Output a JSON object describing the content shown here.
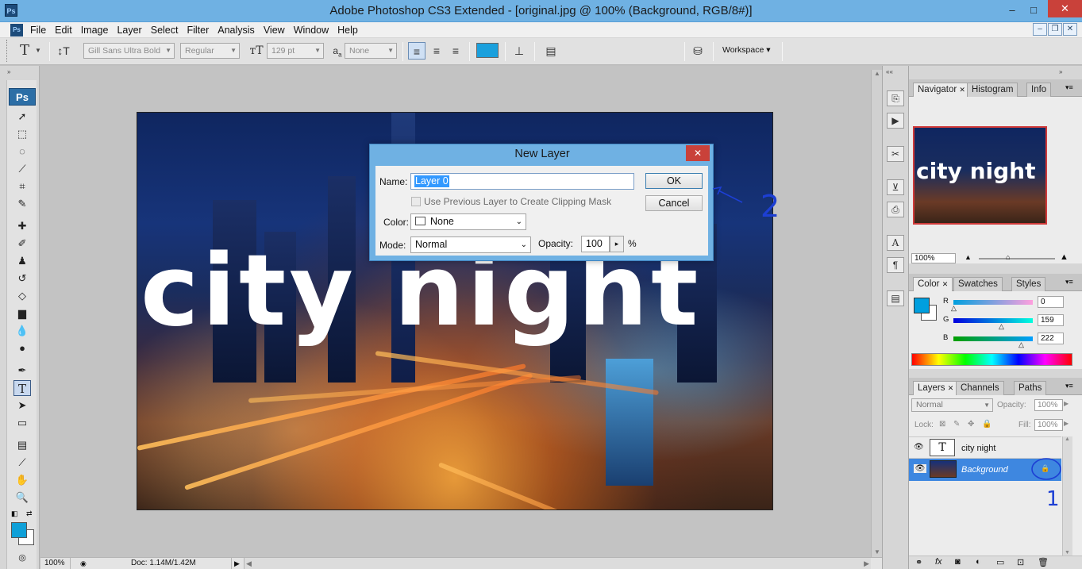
{
  "window": {
    "title": "Adobe Photoshop CS3 Extended - [original.jpg @ 100% (Background, RGB/8#)]",
    "app_icon": "Ps",
    "minimize": "–",
    "maximize": "□",
    "close": "✕"
  },
  "menu": {
    "app_icon": "Ps",
    "items": [
      "File",
      "Edit",
      "Image",
      "Layer",
      "Select",
      "Filter",
      "Analysis",
      "View",
      "Window",
      "Help"
    ],
    "doc_minimize": "–",
    "doc_restore": "❐",
    "doc_close": "✕"
  },
  "options": {
    "tool_glyph": "T",
    "font_family": "Gill Sans Ultra Bold",
    "font_style": "Regular",
    "font_size": "129 pt",
    "antialias_label": "a",
    "antialias": "None",
    "text_color": "#1aa0dd",
    "workspace": "Workspace ▾"
  },
  "toolbox": {
    "badge": "Ps",
    "active_tool": "type-tool",
    "foreground_color": "#0fa0d8",
    "background_color": "#ffffff"
  },
  "canvas": {
    "text_layer_content": "city night"
  },
  "status": {
    "zoom": "100%",
    "doc_info": "Doc: 1.14M/1.42M"
  },
  "navigator": {
    "tabs": [
      "Navigator",
      "Histogram",
      "Info"
    ],
    "thumb_text": "city night",
    "zoom": "100%"
  },
  "color_panel": {
    "tabs": [
      "Color",
      "Swatches",
      "Styles"
    ],
    "r_label": "R",
    "g_label": "G",
    "b_label": "B",
    "r": "0",
    "g": "159",
    "b": "222",
    "fg_color": "#009fde"
  },
  "layers_panel": {
    "tabs": [
      "Layers",
      "Channels",
      "Paths"
    ],
    "blend_mode": "Normal",
    "opacity_label": "Opacity:",
    "opacity": "100%",
    "lock_label": "Lock:",
    "fill_label": "Fill:",
    "fill": "100%",
    "layers": [
      {
        "name": "city night",
        "type": "text",
        "selected": false
      },
      {
        "name": "Background",
        "type": "image",
        "selected": true,
        "locked": true
      }
    ]
  },
  "dialog": {
    "title": "New Layer",
    "close": "✕",
    "name_label": "Name:",
    "name_value": "Layer 0",
    "clip_label": "Use Previous Layer to Create Clipping Mask",
    "color_label": "Color:",
    "color_value": "None",
    "mode_label": "Mode:",
    "mode_value": "Normal",
    "opacity_label": "Opacity:",
    "opacity_value": "100",
    "percent": "%",
    "ok": "OK",
    "cancel": "Cancel"
  },
  "annotations": {
    "one": "1",
    "two": "2"
  }
}
